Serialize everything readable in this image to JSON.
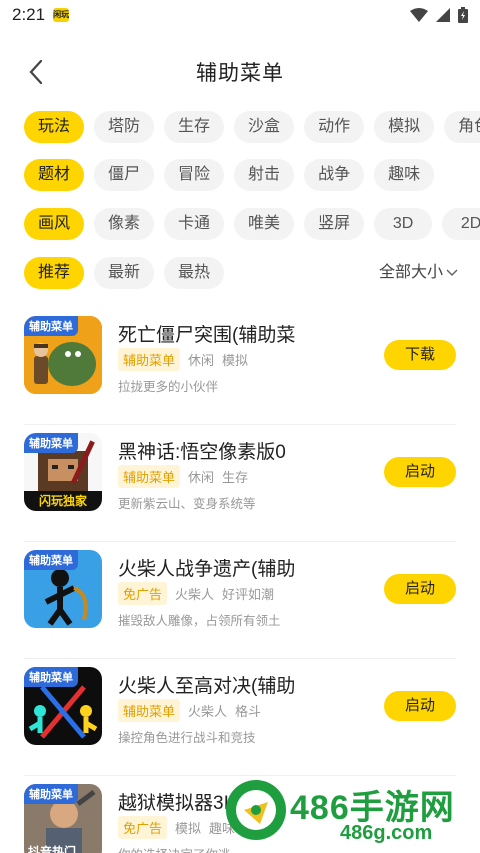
{
  "status_bar": {
    "time": "2:21",
    "app_badge": "闲玩"
  },
  "header": {
    "title": "辅助菜单"
  },
  "filters": {
    "gameplay": [
      "玩法",
      "塔防",
      "生存",
      "沙盒",
      "动作",
      "模拟",
      "角色"
    ],
    "theme": [
      "题材",
      "僵尸",
      "冒险",
      "射击",
      "战争",
      "趣味"
    ],
    "art_style": [
      "画风",
      "像素",
      "卡通",
      "唯美",
      "竖屏",
      "3D",
      "2D"
    ],
    "sort": [
      "推荐",
      "最新",
      "最热"
    ],
    "size_label": "全部大小"
  },
  "games": [
    {
      "badge": "辅助菜单",
      "name": "死亡僵尸突围(辅助菜",
      "tag_main": "辅助菜单",
      "tags": [
        "休闲",
        "模拟"
      ],
      "desc": "拉拢更多的小伙伴",
      "action": "下载",
      "icon": "zombie-game-icon"
    },
    {
      "badge": "辅助菜单",
      "badge_bottom": "闪玩独家",
      "name": "黑神话:悟空像素版0",
      "tag_main": "辅助菜单",
      "tags": [
        "休闲",
        "生存"
      ],
      "desc": "更新紫云山、变身系统等",
      "action": "启动",
      "icon": "wukong-pixel-icon"
    },
    {
      "badge": "辅助菜单",
      "name": "火柴人战争遗产(辅助",
      "tag_main": "免广告",
      "tags": [
        "火柴人",
        "好评如潮"
      ],
      "desc": "摧毁敌人雕像，占领所有领土",
      "action": "启动",
      "icon": "stickman-war-icon"
    },
    {
      "badge": "辅助菜单",
      "name": "火柴人至高对决(辅助",
      "tag_main": "辅助菜单",
      "tags": [
        "火柴人",
        "格斗"
      ],
      "desc": "操控角色进行战斗和竞技",
      "action": "启动",
      "icon": "stickman-duel-icon"
    },
    {
      "badge": "辅助菜单",
      "badge_bottom": "抖音热门",
      "name": "越狱模拟器3I",
      "tag_main": "免广告",
      "tags": [
        "模拟",
        "趣味"
      ],
      "desc": "你的选择决定了你逃",
      "action": "",
      "icon": "prison-escape-icon"
    }
  ],
  "watermark": {
    "main": "486手游网",
    "sub": "486g.com"
  },
  "colors": {
    "accent": "#ffd500",
    "chip_bg": "#f3f3f3",
    "tag_text": "#e0a000",
    "badge_blue": "#2f6bd8",
    "watermark_green": "#1e9e3e"
  }
}
